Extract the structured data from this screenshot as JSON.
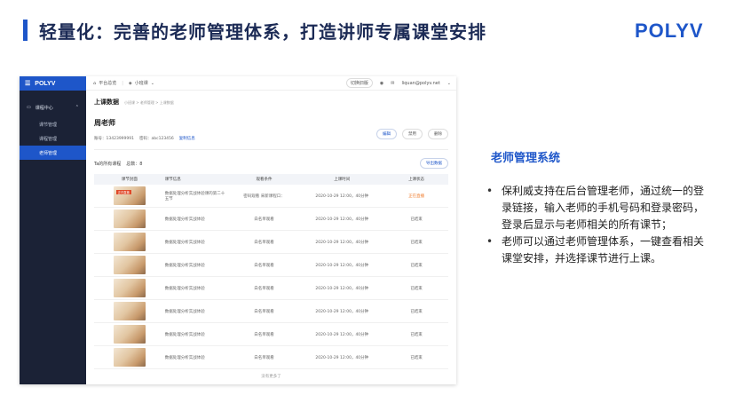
{
  "slide": {
    "title": "轻量化：完善的老师管理体系，打造讲师专属课堂安排",
    "logo": "POLYV"
  },
  "app": {
    "sidebar": {
      "brand": "POLYV",
      "group": "课程中心",
      "items": [
        {
          "label": "课节管理"
        },
        {
          "label": "课程管理"
        },
        {
          "label": "老师管理"
        }
      ]
    },
    "topbar": {
      "home": "平台总览",
      "org": "小班课",
      "switch_label": "切换旧版",
      "user": "liquan@polyv.net"
    },
    "content": {
      "heading": "上课数据",
      "breadcrumb": "小班课 > 老师管理 > 上课数据",
      "teacher_name": "周老师",
      "account": "账号：13423999991",
      "password": "密码：abc123456",
      "copy_link": "复制信息",
      "buttons": {
        "edit": "编辑",
        "disable": "禁用",
        "delete": "删除"
      },
      "section_title": "Ta的所有课程",
      "total": "总数：8",
      "export": "导出数据",
      "columns": [
        "课节封面",
        "课节信息",
        "观看条件",
        "上课时间",
        "上课状态"
      ],
      "rows": [
        {
          "tag": "正在直播",
          "info": "数据处理分析实战体验课的第二十五节",
          "cond": "密码观看 采新课程口：",
          "time": "2020-10-29  12:00，40分钟",
          "status": "正在直播"
        },
        {
          "tag": "",
          "info": "数据处理分析实战体验",
          "cond": "白名单观看",
          "time": "2020-10-29  12:00，40分钟",
          "status": "已结束"
        },
        {
          "tag": "",
          "info": "数据处理分析实战体验",
          "cond": "白名单观看",
          "time": "2020-10-29  12:00，40分钟",
          "status": "已结束"
        },
        {
          "tag": "",
          "info": "数据处理分析实战体验",
          "cond": "白名单观看",
          "time": "2020-10-29  12:00，40分钟",
          "status": "已结束"
        },
        {
          "tag": "",
          "info": "数据处理分析实战体验",
          "cond": "白名单观看",
          "time": "2020-10-29  12:00，40分钟",
          "status": "已结束"
        },
        {
          "tag": "",
          "info": "数据处理分析实战体验",
          "cond": "白名单观看",
          "time": "2020-10-29  12:00，40分钟",
          "status": "已结束"
        },
        {
          "tag": "",
          "info": "数据处理分析实战体验",
          "cond": "白名单观看",
          "time": "2020-10-29  12:00，40分钟",
          "status": "已结束"
        },
        {
          "tag": "",
          "info": "数据处理分析实战体验",
          "cond": "白名单观看",
          "time": "2020-10-29  12:00，40分钟",
          "status": "已结束"
        }
      ],
      "footer": "没有更多了"
    }
  },
  "description": {
    "title": "老师管理系统",
    "bullets": [
      "保利威支持在后台管理老师，通过统一的登录链接，输入老师的手机号码和登录密码，登录后显示与老师相关的所有课节；",
      "老师可以通过老师管理体系，一键查看相关课堂安排，并选择课节进行上课。"
    ]
  },
  "colors": {
    "brand": "#1e56c9",
    "sidebar": "#1b2236",
    "live": "#f07b2b"
  }
}
